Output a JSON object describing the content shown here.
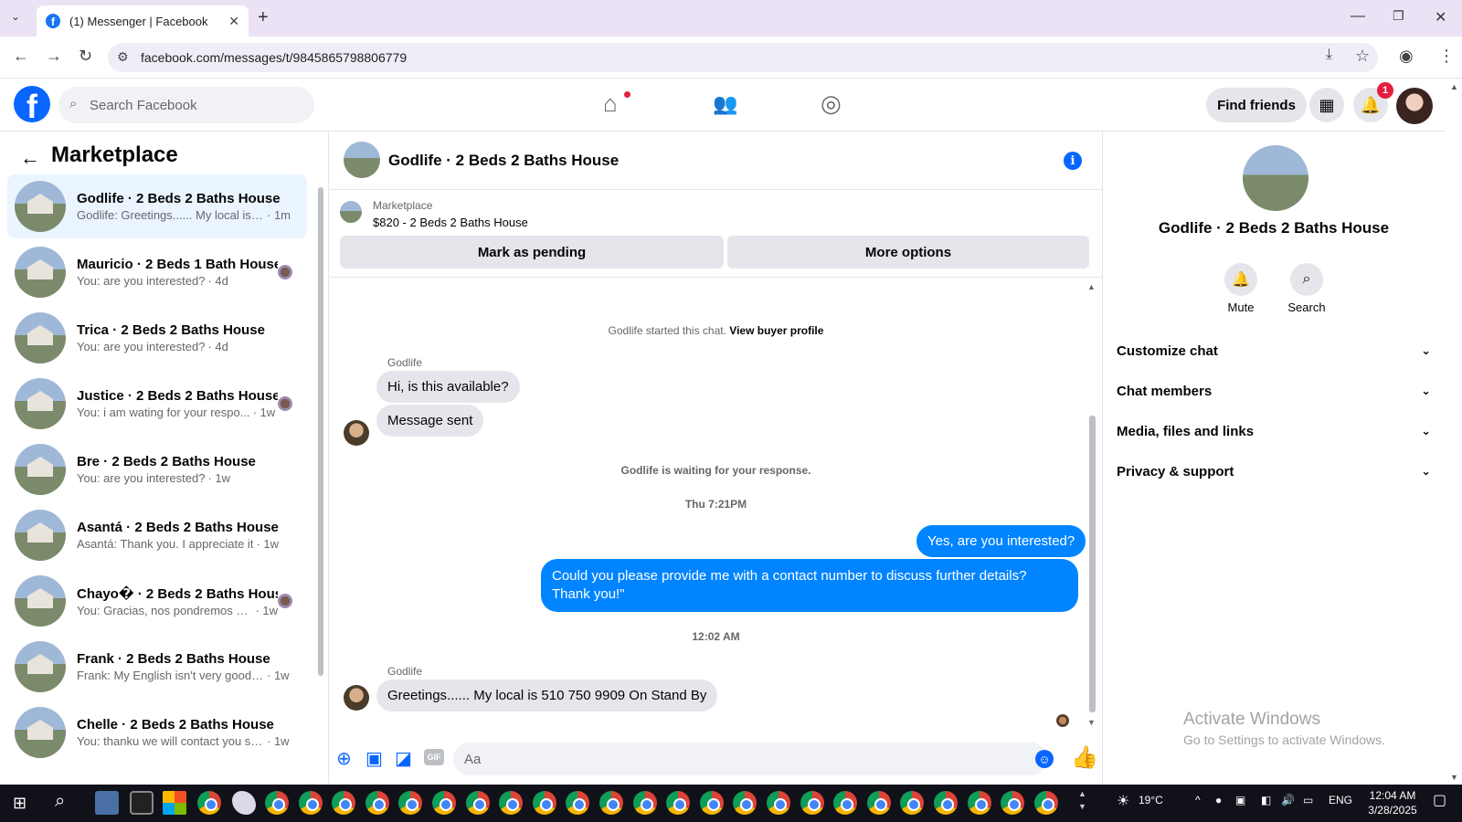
{
  "browser": {
    "tab_title": "(1) Messenger | Facebook",
    "url": "facebook.com/messages/t/9845865798806779"
  },
  "header": {
    "search_placeholder": "Search Facebook",
    "find_friends": "Find friends",
    "notification_count": "1"
  },
  "sidebar": {
    "title": "Marketplace",
    "conversations": [
      {
        "name": "Godlife · 2 Beds 2 Baths House",
        "preview": "Godlife: Greetings...... My local is 5...",
        "time": "· 1m",
        "active": true,
        "seen": false
      },
      {
        "name": "Mauricio · 2 Beds 1 Bath House",
        "preview": "You: are you interested?",
        "time": "· 4d",
        "active": false,
        "seen": true
      },
      {
        "name": "Trica · 2 Beds 2 Baths House",
        "preview": "You: are you interested?",
        "time": "· 4d",
        "active": false,
        "seen": false
      },
      {
        "name": "Justice · 2 Beds 2 Baths House",
        "preview": "You: i am wating for your respo...",
        "time": "· 1w",
        "active": false,
        "seen": true
      },
      {
        "name": "Bre · 2 Beds 2 Baths House",
        "preview": "You: are you interested?",
        "time": "· 1w",
        "active": false,
        "seen": false
      },
      {
        "name": "Asantá · 2 Beds 2 Baths House",
        "preview": "Asantá: Thank you. I appreciate it",
        "time": "· 1w",
        "active": false,
        "seen": false
      },
      {
        "name": "Chayo� · 2 Beds 2 Baths House",
        "preview": "You: Gracias, nos pondremos en...",
        "time": "· 1w",
        "active": false,
        "seen": true
      },
      {
        "name": "Frank · 2 Beds 2 Baths House",
        "preview": "Frank: My English isn't very good, ...",
        "time": "· 1w",
        "active": false,
        "seen": false
      },
      {
        "name": "Chelle · 2 Beds 2 Baths House",
        "preview": "You: thanku we will contact you so...",
        "time": "· 1w",
        "active": false,
        "seen": false
      }
    ]
  },
  "chat": {
    "title": "Godlife · 2 Beds 2 Baths House",
    "listing_label": "Marketplace",
    "listing_price": "$820 - 2 Beds 2 Baths House",
    "mark_pending": "Mark as pending",
    "more_options": "More options",
    "started_text": "Godlife started this chat.",
    "view_buyer_profile": "View buyer profile",
    "sender_name": "Godlife",
    "msg1": "Hi, is this available?",
    "msg2": "Message sent",
    "waiting_text": "Godlife is waiting for your response.",
    "timestamp1": "Thu 7:21PM",
    "out1": "Yes, are you interested?",
    "out2": "Could you please provide me with a contact number to discuss further details? Thank you!\"",
    "timestamp2": "12:02 AM",
    "msg3": "Greetings...... My local is 510 750 9909 On Stand By",
    "composer_placeholder": "Aa"
  },
  "details": {
    "name": "Godlife · 2 Beds 2 Baths House",
    "mute": "Mute",
    "search": "Search",
    "sections": [
      "Customize chat",
      "Chat members",
      "Media, files and links",
      "Privacy & support"
    ]
  },
  "watermark": {
    "line1": "Activate Windows",
    "line2": "Go to Settings to activate Windows."
  },
  "taskbar": {
    "temperature": "19°C",
    "language": "ENG",
    "time": "12:04 AM",
    "date": "3/28/2025"
  }
}
